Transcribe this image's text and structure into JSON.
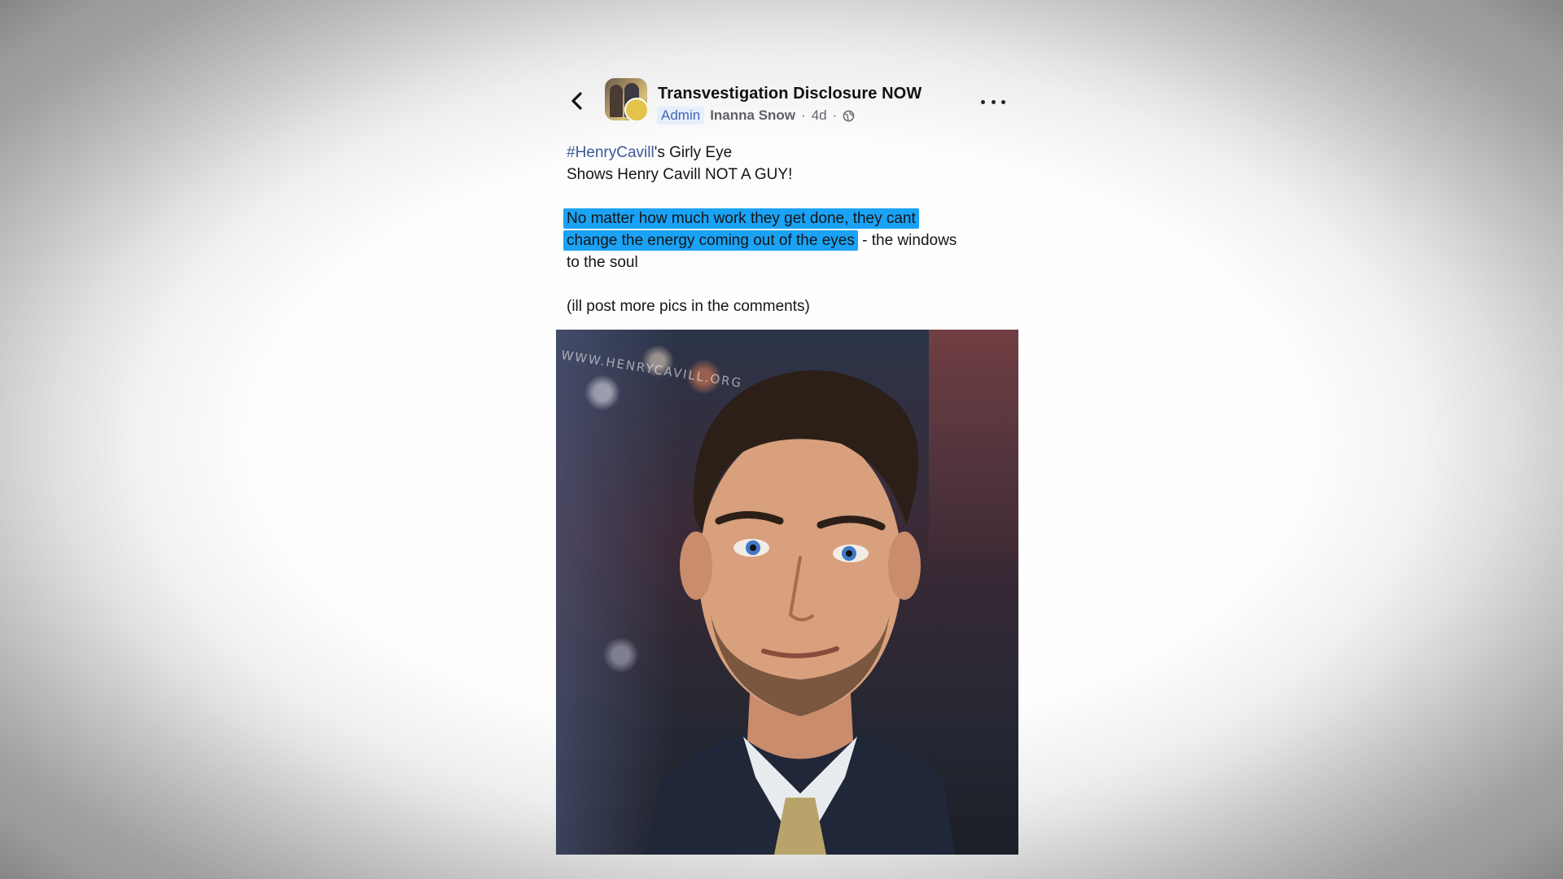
{
  "post": {
    "group_name": "Transvestigation Disclosure NOW",
    "role_badge": "Admin",
    "author": "Inanna Snow",
    "time": "4d",
    "separator": "·",
    "text": {
      "hashtag": "#HenryCavill",
      "line1_rest": "'s Girly Eye",
      "line2": "Shows Henry Cavill NOT A GUY!",
      "highlight_line1": "No matter how much work they get done, they cant",
      "highlight_line2": "change the energy coming out of the eyes",
      "line3_rest": "- the windows",
      "line4": "to the soul",
      "line5": "(ill post more pics in the comments)"
    },
    "image": {
      "watermark": "WWW.HENRYCAVILL.ORG"
    },
    "highlight_color": "#1aa3f5",
    "link_color": "#3b5998"
  },
  "icons": {
    "back": "chevron-left-icon",
    "more": "more-options-icon",
    "privacy": "globe-icon"
  }
}
